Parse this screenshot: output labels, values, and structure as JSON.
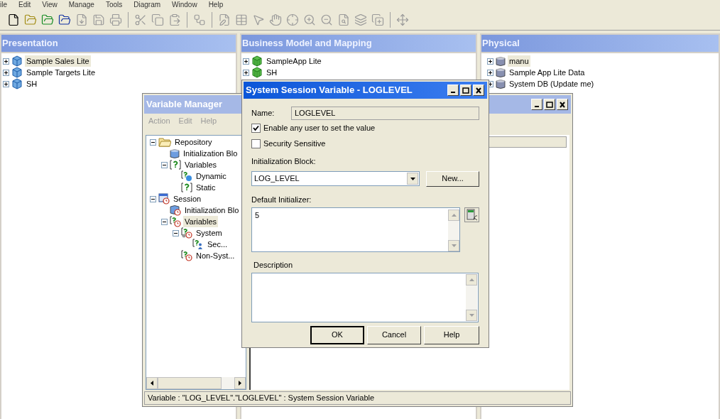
{
  "menubar": [
    {
      "label": "ile"
    },
    {
      "label": "Edit"
    },
    {
      "label": "View"
    },
    {
      "label": "Manage"
    },
    {
      "label": "Tools"
    },
    {
      "label": "Diagram"
    },
    {
      "label": "Window"
    },
    {
      "label": "Help"
    }
  ],
  "toolbar": [
    {
      "kind": "new",
      "disabled": false
    },
    {
      "kind": "open",
      "disabled": false
    },
    {
      "kind": "open_online",
      "disabled": false
    },
    {
      "kind": "open_cache",
      "disabled": false
    },
    {
      "kind": "import",
      "disabled": true
    },
    {
      "kind": "save",
      "disabled": true
    },
    {
      "kind": "print",
      "disabled": true
    },
    {
      "kind": "separator"
    },
    {
      "kind": "cut",
      "disabled": true
    },
    {
      "kind": "copy",
      "disabled": true
    },
    {
      "kind": "paste",
      "disabled": true
    },
    {
      "kind": "separator"
    },
    {
      "kind": "layout",
      "disabled": true
    },
    {
      "kind": "separator"
    },
    {
      "kind": "properties",
      "disabled": true
    },
    {
      "kind": "table",
      "disabled": true
    },
    {
      "kind": "pointer",
      "disabled": true
    },
    {
      "kind": "hand",
      "disabled": true
    },
    {
      "kind": "fit",
      "disabled": true
    },
    {
      "kind": "zoom_in",
      "disabled": true
    },
    {
      "kind": "zoom_out",
      "disabled": true
    },
    {
      "kind": "find",
      "disabled": true
    },
    {
      "kind": "layers",
      "disabled": true
    },
    {
      "kind": "add_layer",
      "disabled": true
    },
    {
      "kind": "separator"
    },
    {
      "kind": "expand",
      "disabled": true
    }
  ],
  "panes": [
    {
      "title": "Presentation",
      "items": [
        {
          "label": "Sample Sales Lite",
          "kind": "subject_area",
          "expanded": false,
          "selected": true
        },
        {
          "label": "Sample Targets Lite",
          "kind": "subject_area",
          "expanded": false,
          "selected": false
        },
        {
          "label": "SH",
          "kind": "subject_area",
          "expanded": false,
          "selected": false
        }
      ]
    },
    {
      "title": "Business Model and Mapping",
      "items": [
        {
          "label": "SampleApp Lite",
          "kind": "business_model",
          "expanded": false,
          "selected": false
        },
        {
          "label": "SH",
          "kind": "business_model",
          "expanded": false,
          "selected": false
        }
      ]
    },
    {
      "title": "Physical",
      "items": [
        {
          "label": "manu",
          "kind": "database",
          "expanded": false,
          "selected": true
        },
        {
          "label": "Sample App Lite Data",
          "kind": "database",
          "expanded": false,
          "selected": false
        },
        {
          "label": "System DB (Update me)",
          "kind": "database",
          "expanded": false,
          "selected": false
        }
      ]
    }
  ],
  "variable_manager": {
    "title": "Variable Manager",
    "menu": [
      {
        "label": "Action",
        "disabled": true
      },
      {
        "label": "Edit",
        "disabled": true
      },
      {
        "label": "Help",
        "disabled": true
      }
    ],
    "tree": [
      {
        "label": "Repository",
        "kind": "folder",
        "expanded": true,
        "selected": false,
        "children": [
          {
            "label": "Initialization Blo",
            "kind": "init_block",
            "selected": false
          },
          {
            "label": "Variables",
            "kind": "variables",
            "expanded": true,
            "selected": false,
            "children": [
              {
                "label": "Dynamic",
                "kind": "dynamic",
                "selected": false
              },
              {
                "label": "Static",
                "kind": "static",
                "selected": false
              }
            ]
          }
        ]
      },
      {
        "label": "Session",
        "kind": "session",
        "expanded": true,
        "selected": false,
        "children": [
          {
            "label": "Initialization Blo",
            "kind": "session_init_block",
            "selected": false
          },
          {
            "label": "Variables",
            "kind": "session_variables",
            "expanded": true,
            "selected": true,
            "children": [
              {
                "label": "System",
                "kind": "system",
                "expanded": true,
                "selected": false,
                "children": [
                  {
                    "label": "Sec...",
                    "kind": "system_variable",
                    "selected": false
                  }
                ]
              },
              {
                "label": "Non-Syst...",
                "kind": "session_variables",
                "selected": false
              }
            ]
          }
        ]
      }
    ],
    "status": "Variable : \"LOG_LEVEL\".\"LOGLEVEL\" : System Session Variable"
  },
  "dialog": {
    "title": "System Session Variable - LOGLEVEL",
    "name_label": "Name:",
    "name_value": "LOGLEVEL",
    "checkboxes": [
      {
        "label": "Enable any user to set the value",
        "checked": true
      },
      {
        "label": "Security Sensitive",
        "checked": false
      }
    ],
    "init_block_label": "Initialization Block:",
    "init_block_value": "LOG_LEVEL",
    "new_button": "New...",
    "default_initializer_label": "Default Initializer:",
    "default_initializer_value": "5",
    "description_label": "Description",
    "buttons": [
      {
        "label": "OK",
        "default": true
      },
      {
        "label": "Cancel",
        "default": false
      },
      {
        "label": "Help",
        "default": false
      }
    ]
  }
}
